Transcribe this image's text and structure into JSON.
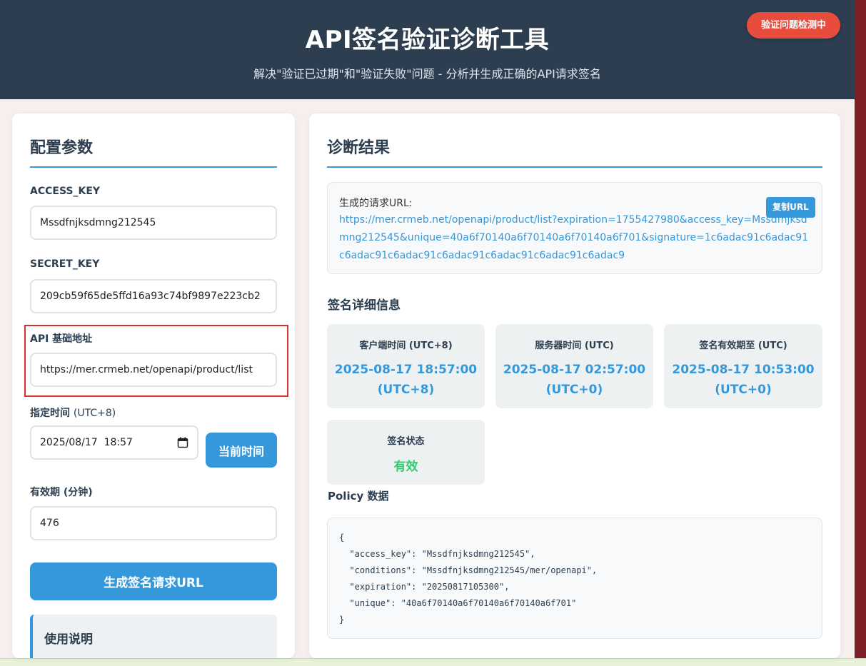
{
  "header": {
    "title": "API签名验证诊断工具",
    "subtitle": "解决\"验证已过期\"和\"验证失败\"问题 - 分析并生成正确的API请求签名",
    "status_badge": "验证问题检测中"
  },
  "config": {
    "title": "配置参数",
    "access_key_label": "ACCESS_KEY",
    "access_key_value": "Mssdfnjksdmng212545",
    "secret_key_label": "SECRET_KEY",
    "secret_key_value": "209cb59f65de5ffd16a93c74bf9897e223cb2",
    "api_base_label": "API 基础地址",
    "api_base_value": "https://mer.crmeb.net/openapi/product/list",
    "time_label": "指定时间",
    "time_label_suffix": "(UTC+8)",
    "time_value": "2025/08/17  18:57",
    "current_time_button": "当前时间",
    "validity_label": "有效期",
    "validity_label_suffix": "(分钟)",
    "validity_value": "476",
    "generate_button": "生成签名请求URL",
    "help_title": "使用说明"
  },
  "result": {
    "title": "诊断结果",
    "url_label": "生成的请求URL:",
    "url": "https://mer.crmeb.net/openapi/product/list?expiration=1755427980&access_key=Mssdfnjksdmng212545&unique=40a6f70140a6f70140a6f70140a6f701&signature=1c6adac91c6adac91c6adac91c6adac91c6adac91c6adac91c6adac91c6adac9",
    "copy_button": "复制URL",
    "details_heading": "签名详细信息",
    "client_time_label": "客户端时间 (UTC+8)",
    "client_time_value": "2025-08-17 18:57:00",
    "client_time_zone": "(UTC+8)",
    "server_time_label": "服务器时间 (UTC)",
    "server_time_value": "2025-08-17 02:57:00",
    "server_time_zone": "(UTC+0)",
    "expiry_label": "签名有效期至 (UTC)",
    "expiry_value": "2025-08-17 10:53:00",
    "expiry_zone": "(UTC+0)",
    "status_label": "签名状态",
    "status_value": "有效",
    "policy_label": "Policy 数据",
    "policy_json": "{\n  \"access_key\": \"Mssdfnjksdmng212545\",\n  \"conditions\": \"Mssdfnjksdmng212545/mer/openapi\",\n  \"expiration\": \"20250817105300\",\n  \"unique\": \"40a6f70140a6f70140a6f70140a6f701\"\n}"
  }
}
